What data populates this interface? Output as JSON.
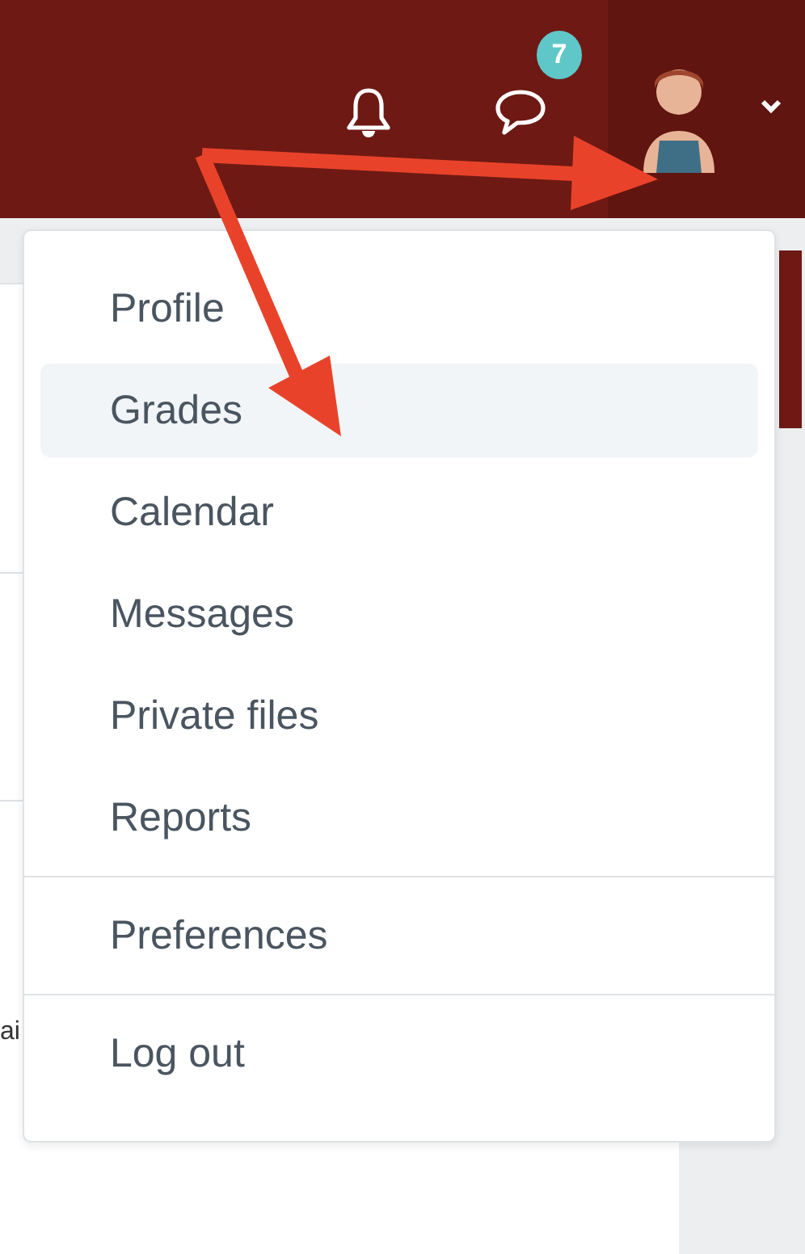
{
  "header": {
    "message_badge": "7"
  },
  "page": {
    "cut_text": "ai"
  },
  "user_menu": {
    "groups": [
      [
        {
          "label": "Profile",
          "selected": false
        },
        {
          "label": "Grades",
          "selected": true
        },
        {
          "label": "Calendar",
          "selected": false
        },
        {
          "label": "Messages",
          "selected": false
        },
        {
          "label": "Private files",
          "selected": false
        },
        {
          "label": "Reports",
          "selected": false
        }
      ],
      [
        {
          "label": "Preferences",
          "selected": false
        }
      ],
      [
        {
          "label": "Log out",
          "selected": false
        }
      ]
    ]
  }
}
